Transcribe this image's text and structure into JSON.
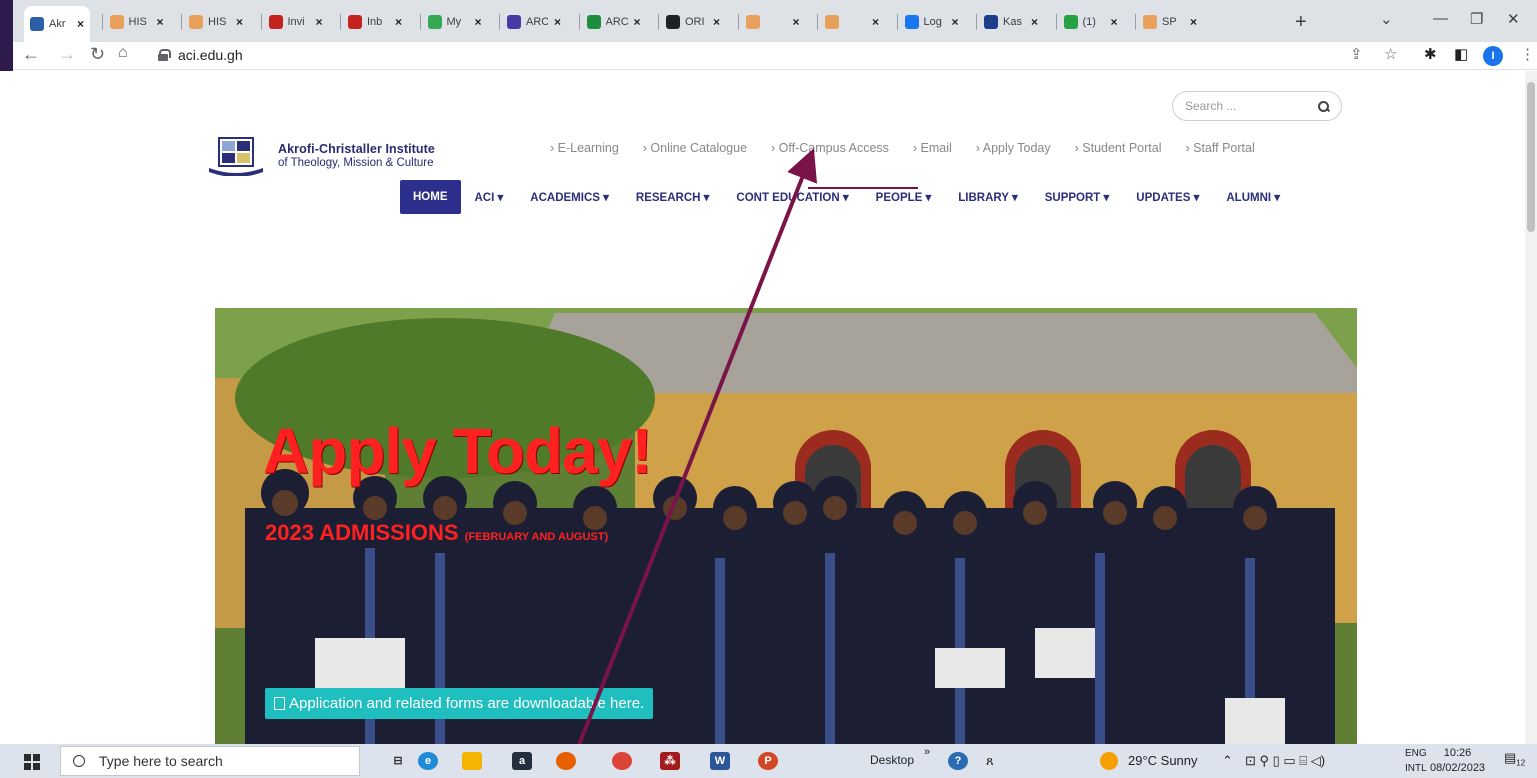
{
  "browser": {
    "tabs": [
      {
        "label": "Akr",
        "color": "#2b5fa6"
      },
      {
        "label": "HIS",
        "color": "#e8a05a"
      },
      {
        "label": "HIS",
        "color": "#e8a05a"
      },
      {
        "label": "Invi",
        "color": "#c5221f"
      },
      {
        "label": "Inb",
        "color": "#c5221f"
      },
      {
        "label": "My",
        "color": "#34a853"
      },
      {
        "label": "ARC",
        "color": "#4a3aa8"
      },
      {
        "label": "ARC",
        "color": "#1e8e3e"
      },
      {
        "label": "ORI",
        "color": "#202124"
      },
      {
        "label": "",
        "color": "#e8a05a"
      },
      {
        "label": "",
        "color": "#e8a05a"
      },
      {
        "label": "Log",
        "color": "#1877f2"
      },
      {
        "label": "Kas",
        "color": "#1a3e8c"
      },
      {
        "label": "(1)",
        "color": "#25a244"
      },
      {
        "label": "SP",
        "color": "#e8a05a"
      }
    ],
    "url": "aci.edu.gh",
    "profile_initial": "I"
  },
  "site": {
    "search_placeholder": "Search ...",
    "brand_line1": "Akrofi-Christaller Institute",
    "brand_line2": "of Theology, Mission & Culture",
    "top_links": [
      "› E-Learning",
      "› Online Catalogue",
      "› Off-Campus Access",
      "› Email",
      "› Apply Today",
      "› Student Portal",
      "› Staff Portal"
    ],
    "main_nav": [
      "HOME",
      "ACI ▾",
      "ACADEMICS ▾",
      "RESEARCH ▾",
      "CONT EDUCATION ▾",
      "PEOPLE ▾",
      "LIBRARY ▾",
      "SUPPORT ▾",
      "UPDATES ▾",
      "ALUMNI ▾"
    ],
    "hero": {
      "headline": "Apply Today!",
      "admissions": "2023 ADMISSIONS",
      "admissions_note": "(FEBRUARY AND AUGUST)",
      "forms_button": "Application and related forms are downloadable here."
    }
  },
  "taskbar": {
    "search_placeholder": "Type here to search",
    "desktop_label": "Desktop",
    "weather": "29°C  Sunny",
    "lang_line1": "ENG",
    "lang_line2": "INTL",
    "time": "10:26",
    "date": "08/02/2023",
    "notif_count": "12"
  },
  "colors": {
    "brand_navy": "#2b2f7a",
    "home_bg": "#2d2f8c",
    "headline_red": "#ff2020",
    "forms_teal": "#1fbfbf",
    "annotation_arrow": "#7a1448"
  }
}
